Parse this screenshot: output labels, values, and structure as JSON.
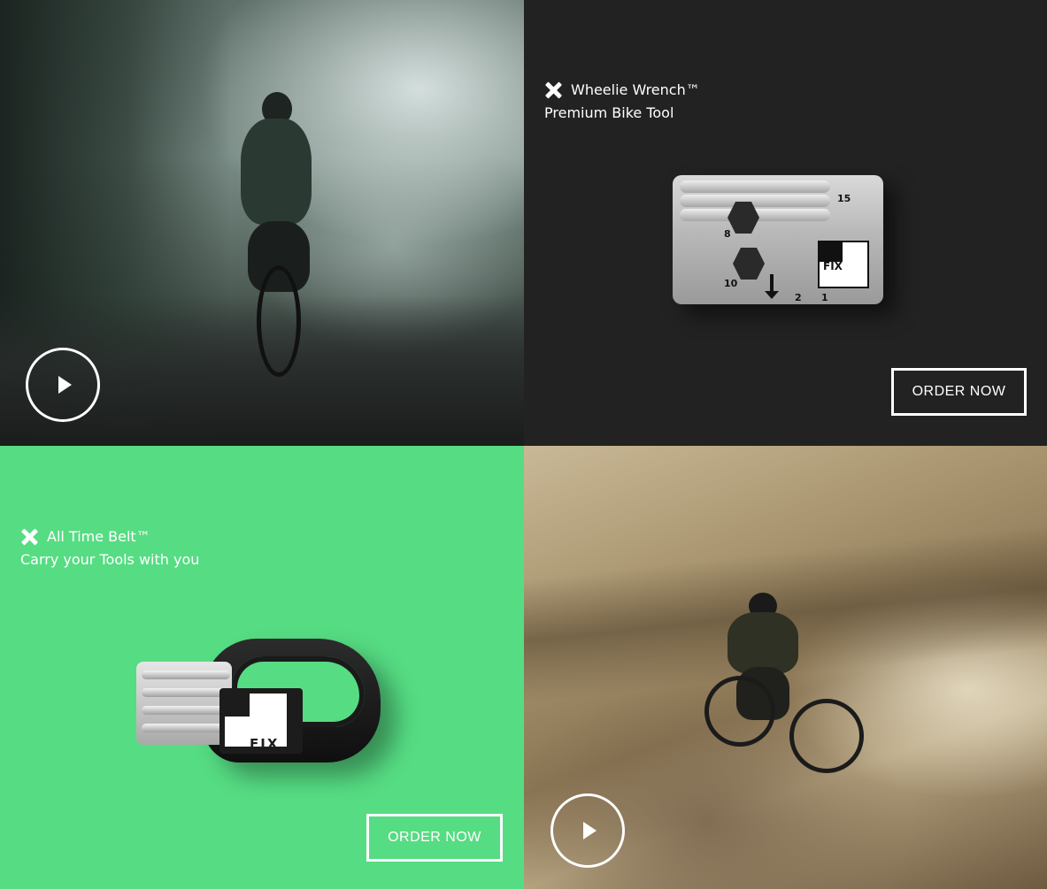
{
  "hero_video_1": {
    "play_label": "Play video",
    "icon": "play-icon"
  },
  "product_1": {
    "name": "Wheelie Wrench™",
    "tagline": "Premium Bike Tool",
    "brand_icon": "x-icon",
    "tool_marks": [
      "15",
      "8",
      "10",
      "2",
      "1"
    ],
    "logo_text": "FIX",
    "order_label": "ORDER NOW",
    "background": "#222222"
  },
  "product_2": {
    "name": "All Time Belt™",
    "tagline": "Carry your Tools with you",
    "brand_icon": "x-icon",
    "logo_text": "FIX",
    "order_label": "ORDER NOW",
    "background": "#56dc83"
  },
  "hero_video_2": {
    "play_label": "Play video",
    "icon": "play-icon"
  }
}
